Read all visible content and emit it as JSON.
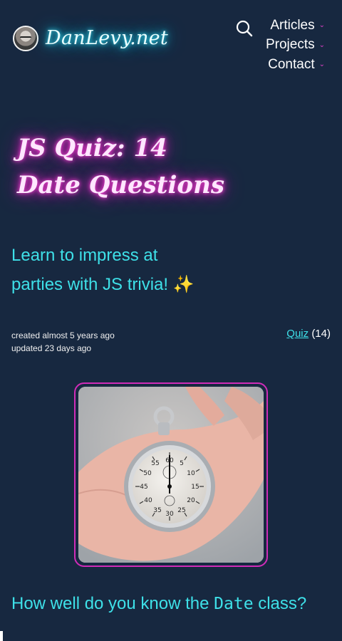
{
  "header": {
    "site_title": "DanLevy.net",
    "nav": [
      {
        "label": "Articles"
      },
      {
        "label": "Projects"
      },
      {
        "label": "Contact"
      }
    ],
    "icons": {
      "search": "search-icon",
      "dropdown": "chevron-down-icon",
      "avatar": "avatar-photo"
    }
  },
  "hero": {
    "title_line1": "JS Quiz: 14",
    "title_line2": "Date Questions",
    "subtitle_line1": "Learn to impress at",
    "subtitle_line2": "parties with JS trivia! ✨"
  },
  "meta": {
    "created": "created almost 5 years ago",
    "updated": "updated 23 days ago",
    "tag_label": "Quiz",
    "tag_count": "(14)"
  },
  "content": {
    "section_heading_prefix": "How well do you know the ",
    "section_heading_code": "Date",
    "section_heading_suffix": " class?"
  },
  "colors": {
    "background": "#172840",
    "accent_cyan": "#3ee0e8",
    "accent_magenta": "#d02cb8"
  }
}
